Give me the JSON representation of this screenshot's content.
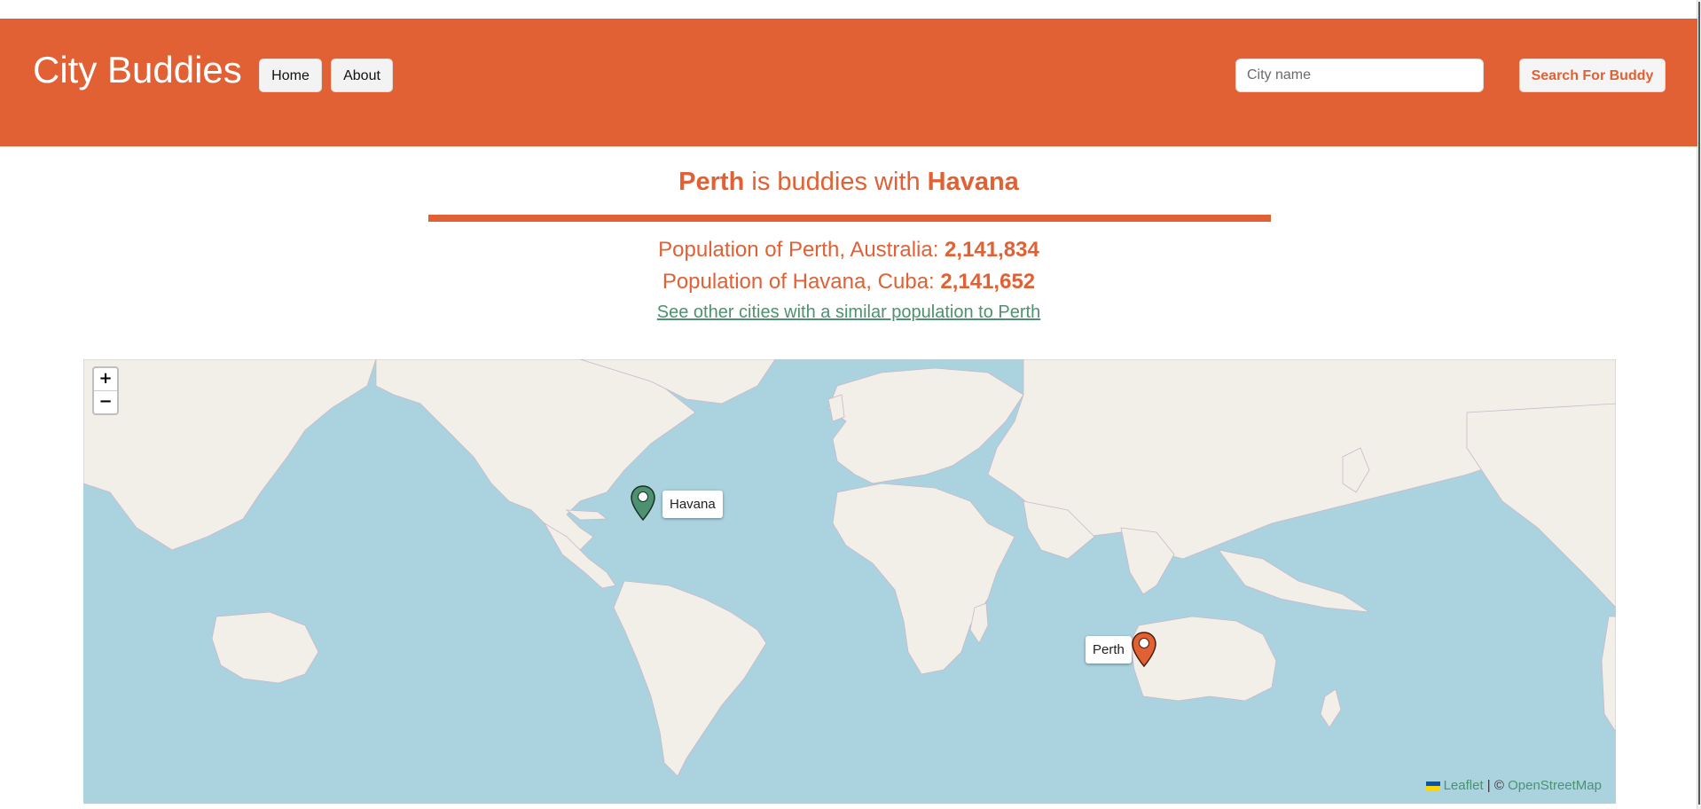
{
  "header": {
    "brand": "City Buddies",
    "nav": {
      "home": "Home",
      "about": "About"
    },
    "search": {
      "placeholder": "City name",
      "button": "Search For Buddy"
    }
  },
  "headline": {
    "city_a": "Perth",
    "middle": " is buddies with ",
    "city_b": "Havana"
  },
  "population": {
    "line1_label": "Population of Perth, Australia: ",
    "line1_value": "2,141,834",
    "line2_label": "Population of Havana, Cuba: ",
    "line2_value": "2,141,652"
  },
  "similar_link": "See other cities with a similar population to Perth",
  "map": {
    "zoom_in": "+",
    "zoom_out": "−",
    "markers": [
      {
        "label": "Havana",
        "color": "#4c9270",
        "lat": 23.1,
        "lon": -82.4
      },
      {
        "label": "Perth",
        "color": "#e16034",
        "lat": -31.95,
        "lon": 115.86
      }
    ],
    "attribution": {
      "leaflet": "Leaflet",
      "separator": " | © ",
      "osm": "OpenStreetMap"
    }
  },
  "colors": {
    "brand": "#e16034",
    "link": "#4c9270",
    "water": "#aad3df",
    "land": "#f2efe9"
  }
}
